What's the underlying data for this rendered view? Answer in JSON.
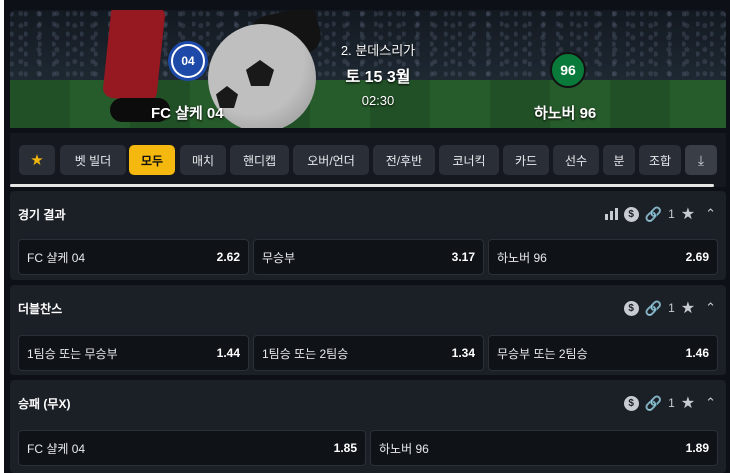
{
  "match": {
    "league": "2. 분데스리가",
    "date": "토 15 3월",
    "time": "02:30",
    "home": {
      "name": "FC 샬케 04",
      "logo_text": "04",
      "logo_icon": "schalke-crest-icon"
    },
    "away": {
      "name": "하노버 96",
      "logo_text": "96",
      "logo_icon": "hannover-crest-icon"
    }
  },
  "tabs": [
    {
      "label": "★",
      "icon": "star-icon"
    },
    {
      "label": "벳 빌더"
    },
    {
      "label": "모두",
      "active": true
    },
    {
      "label": "매치"
    },
    {
      "label": "핸디캡"
    },
    {
      "label": "오버/언더"
    },
    {
      "label": "전/후반"
    },
    {
      "label": "코너킥"
    },
    {
      "label": "카드"
    },
    {
      "label": "선수"
    },
    {
      "label": "분"
    },
    {
      "label": "조합"
    }
  ],
  "tabs_scroll_icon": "⤓",
  "markets": [
    {
      "title": "경기 결과",
      "link_count": "1",
      "has_stats": true,
      "outcomes": [
        {
          "label": "FC 샬케 04",
          "price": "2.62"
        },
        {
          "label": "무승부",
          "price": "3.17"
        },
        {
          "label": "하노버 96",
          "price": "2.69"
        }
      ]
    },
    {
      "title": "더블찬스",
      "link_count": "1",
      "has_stats": false,
      "outcomes": [
        {
          "label": "1팀승 또는 무승부",
          "price": "1.44"
        },
        {
          "label": "1팀승 또는 2팀승",
          "price": "1.34"
        },
        {
          "label": "무승부 또는 2팀승",
          "price": "1.46"
        }
      ]
    },
    {
      "title": "승패 (무X)",
      "link_count": "1",
      "has_stats": false,
      "outcomes": [
        {
          "label": "FC 샬케 04",
          "price": "1.85"
        },
        {
          "label": "하노버 96",
          "price": "1.89"
        }
      ]
    }
  ],
  "icons": {
    "dollar": "$",
    "link": "🔗",
    "star": "★",
    "chevron": "⌃"
  },
  "colors": {
    "accent": "#f5b80f",
    "background": "#0d1117",
    "panel": "#1b1f26"
  }
}
